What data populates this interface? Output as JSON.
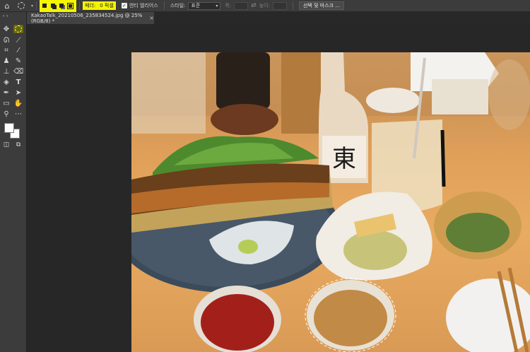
{
  "options_bar": {
    "home_icon": "home-icon",
    "tool_icon": "elliptical-marquee-icon",
    "feather_label": "페더:",
    "feather_value": "0 픽셀",
    "antialias_label": "앤티 엘리어스",
    "antialias_checked": true,
    "style_label": "스타일:",
    "style_value": "표준",
    "width_label": "폭:",
    "height_label": "높이:",
    "select_mask_button": "선택 및 마스크 ...",
    "highlight_color": "#f5f500"
  },
  "document_tab": {
    "title": "KakaoTalk_20210506_235834524.jpg @ 25% (RGB/8) *",
    "close": "×"
  },
  "toolbar": {
    "grip": "••",
    "tools": [
      "move-icon",
      "elliptical-marquee-icon",
      "lasso-icon",
      "quick-select-icon",
      "crop-icon",
      "eyedropper-icon",
      "healing-brush-icon",
      "brush-icon",
      "clone-stamp-icon",
      "eraser-icon",
      "gradient-icon",
      "type-icon",
      "pen-icon",
      "path-select-icon",
      "rectangle-icon",
      "hand-icon",
      "zoom-icon",
      "more-tools-icon",
      "foreground-background-colors",
      "quick-mask-icon",
      "screen-mode-icon"
    ],
    "active_tool": "elliptical-marquee-icon"
  },
  "photo": {
    "description_label": "",
    "bottle_label": "東"
  }
}
